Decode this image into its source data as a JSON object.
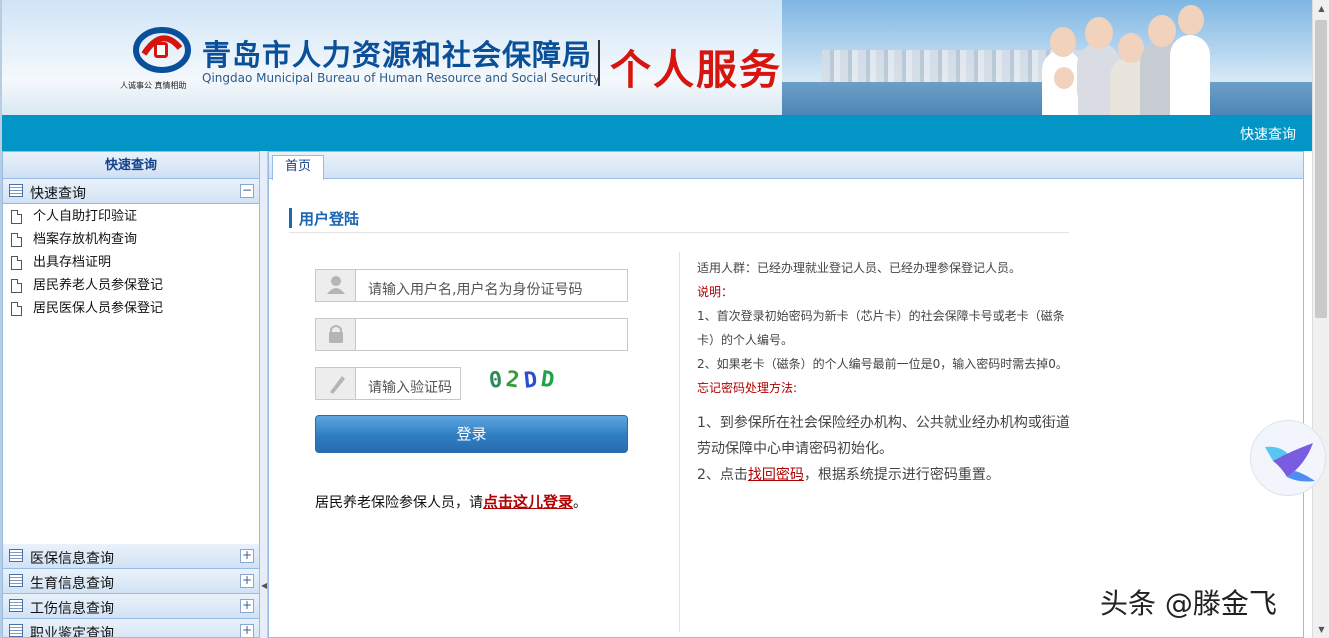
{
  "header": {
    "org_cn": "青岛市人力资源和社会保障局",
    "org_en": "Qingdao Municipal Bureau of Human Resource and Social Security",
    "slogan": "人诚事公 真情相助",
    "service_title": "个人服务",
    "quick_link": "快速查询"
  },
  "sidebar": {
    "title": "快速查询",
    "open_group": {
      "label": "快速查询",
      "items": [
        "个人自助打印验证",
        "档案存放机构查询",
        "出具存档证明",
        "居民养老人员参保登记",
        "居民医保人员参保登记"
      ]
    },
    "groups": [
      "医保信息查询",
      "生育信息查询",
      "工伤信息查询",
      "职业鉴定查询"
    ]
  },
  "tabs": [
    "首页"
  ],
  "login": {
    "title": "用户登陆",
    "username_placeholder": "请输入用户名,用户名为身份证号码",
    "password_placeholder": "",
    "captcha_placeholder": "请输入验证码",
    "captcha_code": "02DD",
    "button": "登录",
    "resident_prefix": "居民养老保险参保人员，请",
    "resident_link": "点击这儿登录",
    "resident_suffix": "。"
  },
  "info": {
    "audience": "适用人群：已经办理就业登记人员、已经办理参保登记人员。",
    "note_title": "说明：",
    "note_1": "1、首次登录初始密码为新卡（芯片卡）的社会保障卡号或老卡（磁条卡）的个人编号。",
    "note_2": "2、如果老卡（磁条）的个人编号最前一位是0，输入密码时需去掉0。",
    "forgot_title": "忘记密码处理方法:",
    "forgot_1": "1、到参保所在社会保险经办机构、公共就业经办机构或街道劳动保障中心申请密码初始化。",
    "forgot_2_prefix": "2、点击",
    "forgot_2_link": "找回密码",
    "forgot_2_suffix": "，根据系统提示进行密码重置。"
  },
  "watermark": "头条 @滕金飞",
  "colors": {
    "topbar": "#0495c7",
    "brand_blue": "#0a4f99",
    "service_red": "#d7150f",
    "link_red": "#b00000"
  }
}
